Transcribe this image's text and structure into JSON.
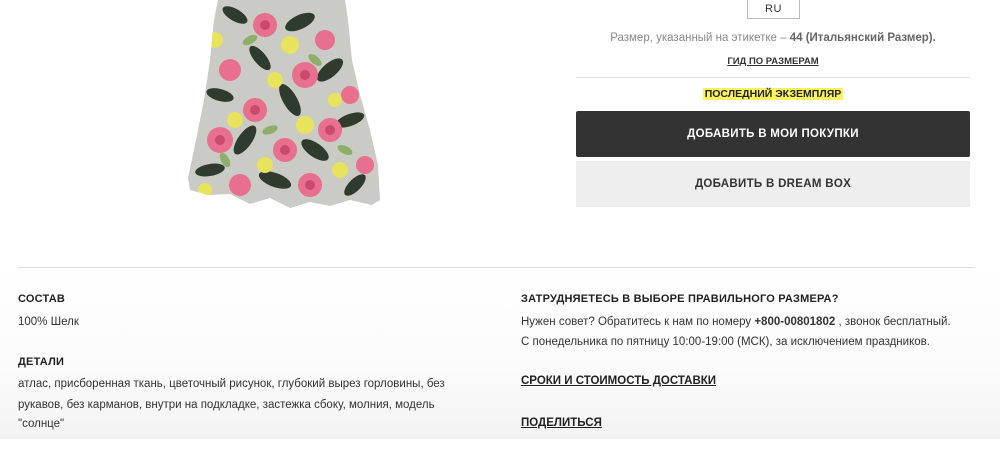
{
  "product": {
    "image_alt": "floral dress"
  },
  "purchase": {
    "size_selected": "RU",
    "size_note_prefix": "Размер, указанный на этикетке – ",
    "size_note_value": "44 (Итальянский Размер).",
    "size_guide_link": "ГИД ПО РАЗМЕРАМ",
    "last_item_label": "ПОСЛЕДНИЙ ЭКЗЕМПЛЯР",
    "add_to_cart_label": "ДОБАВИТЬ В МОИ ПОКУПКИ",
    "add_to_dreambox_label": "ДОБАВИТЬ В DREAM BOX",
    "highlight_color": "#fbf35d",
    "primary_button_color": "#333333"
  },
  "details": {
    "composition_heading": "СОСТАВ",
    "composition_value": "100% Шелк",
    "details_heading": "ДЕТАЛИ",
    "details_lines": [
      "атлас, присборенная ткань, цветочный рисунок, глубокий вырез горловины, без",
      "рукавов, без карманов, внутри на подкладке, застежка сбоку, молния, модель",
      "\"солнце\""
    ]
  },
  "help": {
    "heading": "ЗАТРУДНЯЕТЕСЬ В ВЫБОРЕ ПРАВИЛЬНОГО РАЗМЕРА?",
    "line1_prefix": "Нужен совет? Обратитесь к нам по номеру ",
    "phone": "+800-00801802",
    "line1_suffix": " , звонок бесплатный.",
    "line2": "С понедельника по пятницу 10:00-19:00 (МСК), за исключением праздников.",
    "delivery_link": "СРОКИ И СТОИМОСТЬ ДОСТАВКИ",
    "share_link": "ПОДЕЛИТЬСЯ"
  }
}
